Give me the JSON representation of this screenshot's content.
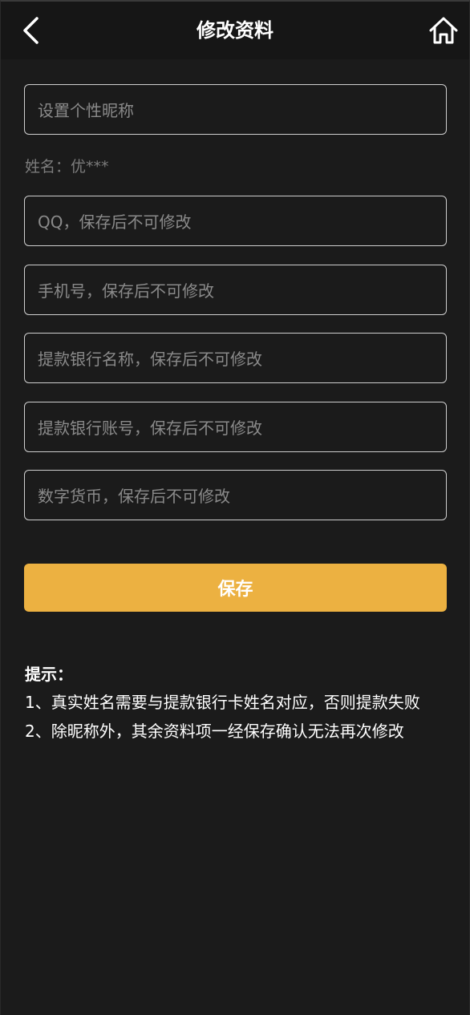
{
  "header": {
    "title": "修改资料",
    "back_icon": "chevron-left-icon",
    "home_icon": "home-icon"
  },
  "form": {
    "nickname_placeholder": "设置个性昵称",
    "name_text": "姓名：优***",
    "qq_placeholder": "QQ，保存后不可修改",
    "phone_placeholder": "手机号，保存后不可修改",
    "bank_name_placeholder": "提款银行名称，保存后不可修改",
    "bank_account_placeholder": "提款银行账号，保存后不可修改",
    "crypto_placeholder": "数字货币，保存后不可修改"
  },
  "save_label": "保存",
  "tips": {
    "title": "提示：",
    "items": [
      "1、真实姓名需要与提款银行卡姓名对应，否则提款失败",
      "2、除昵称外，其余资料项一经保存确认无法再次修改"
    ]
  },
  "colors": {
    "background": "#1b1b1b",
    "header": "#161616",
    "accent": "#ecb141",
    "placeholder": "#8a8a8a"
  }
}
